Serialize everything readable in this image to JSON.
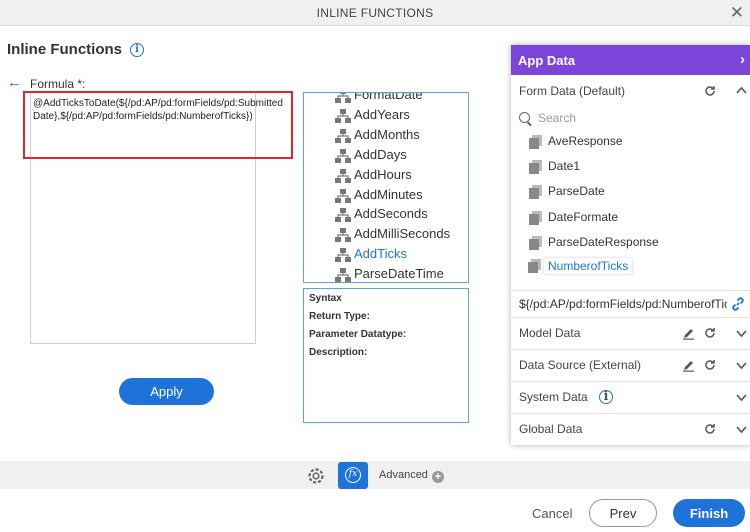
{
  "window": {
    "title": "INLINE FUNCTIONS"
  },
  "page": {
    "heading": "Inline Functions"
  },
  "formula": {
    "label": "Formula *:",
    "value": "@AddTicksToDate(${/pd:AP/pd:formFields/pd:SubmittedDate},${/pd:AP/pd:formFields/pd:NumberofTicks})"
  },
  "apply_label": "Apply",
  "functions": [
    {
      "label": "FormatDate",
      "active": false
    },
    {
      "label": "AddYears",
      "active": false
    },
    {
      "label": "AddMonths",
      "active": false
    },
    {
      "label": "AddDays",
      "active": false
    },
    {
      "label": "AddHours",
      "active": false
    },
    {
      "label": "AddMinutes",
      "active": false
    },
    {
      "label": "AddSeconds",
      "active": false
    },
    {
      "label": "AddMilliSeconds",
      "active": false
    },
    {
      "label": "AddTicks",
      "active": true
    },
    {
      "label": "ParseDateTime",
      "active": false
    }
  ],
  "description": {
    "syntax": "Syntax",
    "return_type": "Return Type:",
    "parameter_datatype": "Parameter Datatype:",
    "description": "Description:"
  },
  "app_data": {
    "title": "App Data",
    "form_data": "Form Data (Default)",
    "search_placeholder": "Search",
    "fields": [
      {
        "label": "AveResponse",
        "active": false
      },
      {
        "label": "Date1",
        "active": false
      },
      {
        "label": "ParseDate",
        "active": false
      },
      {
        "label": "DateFormate",
        "active": false
      },
      {
        "label": "ParseDateResponse",
        "active": false
      },
      {
        "label": "NumberofTicks",
        "active": true
      }
    ],
    "selected_path": "${/pd:AP/pd:formFields/pd:NumberofTicks}",
    "model_data": "Model Data",
    "data_source": "Data Source (External)",
    "system_data": "System Data",
    "global_data": "Global Data"
  },
  "footer": {
    "advanced_label": "Advanced",
    "cancel_label": "Cancel",
    "prev_label": "Prev",
    "finish_label": "Finish"
  },
  "colors": {
    "accent": "#1e73d8",
    "app_data_header": "#7a45d8",
    "highlight": "#e0282c"
  }
}
